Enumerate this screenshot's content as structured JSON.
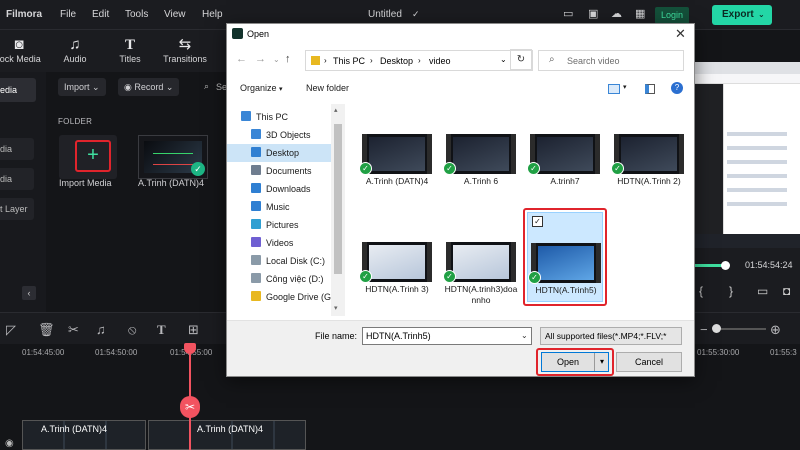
{
  "app": {
    "name": "Filmora",
    "menu": [
      "File",
      "Edit",
      "Tools",
      "View",
      "Help"
    ],
    "project_title": "Untitled",
    "login_label": "Login",
    "export_label": "Export"
  },
  "toolbar": {
    "items": [
      {
        "label": "tock Media",
        "icon": "stock-media-icon"
      },
      {
        "label": "Audio",
        "icon": "music-note-icon"
      },
      {
        "label": "Titles",
        "icon": "text-t-icon"
      },
      {
        "label": "Transitions",
        "icon": "transitions-icon"
      }
    ]
  },
  "sidebar": {
    "items": [
      "edia",
      "dia",
      "dia",
      "t Layer"
    ]
  },
  "media_panel": {
    "import_label": "Import",
    "record_label": "Record",
    "search_stub": "Se",
    "folder_label": "FOLDER",
    "import_media_label": "Import Media",
    "clip_label": "A.Trinh  (DATN)4"
  },
  "preview": {
    "timecode": "01:54:54:24"
  },
  "timeline": {
    "ticks": [
      "01:54:45:00",
      "01:54:50:00",
      "01:54:55:00",
      "01:55:30:00",
      "01:55:3"
    ],
    "clips": [
      {
        "label": "A.Trinh  (DATN)4"
      },
      {
        "label": "A.Trinh  (DATN)4"
      }
    ]
  },
  "dialog": {
    "title": "Open",
    "breadcrumb": [
      "This PC",
      "Desktop",
      "video"
    ],
    "search_placeholder": "Search video",
    "organize_label": "Organize",
    "new_folder_label": "New folder",
    "nav": [
      {
        "label": "This PC",
        "color": "#3a86d6"
      },
      {
        "label": "3D Objects",
        "color": "#3a86d6"
      },
      {
        "label": "Desktop",
        "color": "#2f7fd2"
      },
      {
        "label": "Documents",
        "color": "#6f7d8f"
      },
      {
        "label": "Downloads",
        "color": "#2f7fd2"
      },
      {
        "label": "Music",
        "color": "#2f7fd2"
      },
      {
        "label": "Pictures",
        "color": "#2f9fd2"
      },
      {
        "label": "Videos",
        "color": "#6f5fd2"
      },
      {
        "label": "Local Disk (C:)",
        "color": "#8a9aa8"
      },
      {
        "label": "Công việc (D:)",
        "color": "#8a9aa8"
      },
      {
        "label": "Google Drive (G:",
        "color": "#e8b820"
      }
    ],
    "files": [
      {
        "name": "A.Trinh  (DATN)4",
        "style": "dark"
      },
      {
        "name": "A.Trinh 6",
        "style": "dark"
      },
      {
        "name": "A.trinh7",
        "style": "dark"
      },
      {
        "name": "HDTN(A.Trinh 2)",
        "style": "dark"
      },
      {
        "name": "HDTN(A.Trinh5)",
        "style": "blue"
      },
      {
        "name": "HDTN(A.Trinh 3)",
        "style": "light"
      },
      {
        "name": "HDTN(A.trinh3)doannho",
        "style": "light"
      },
      {
        "name": "",
        "style": "dark"
      }
    ],
    "file_name_label": "File name:",
    "file_name_value": "HDTN(A.Trinh5)",
    "filter_value": "All supported files(*.MP4;*.FLV;*",
    "open_label": "Open",
    "cancel_label": "Cancel"
  }
}
